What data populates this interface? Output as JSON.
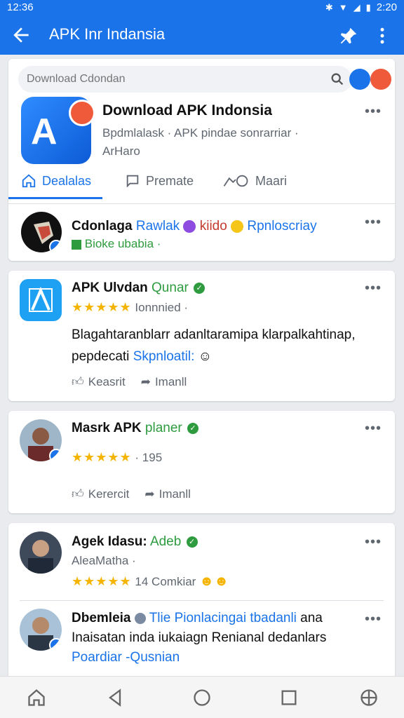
{
  "status_bar": {
    "time": "12:36",
    "clock_right": "2:20"
  },
  "app_bar": {
    "title": "APK Inr Indansia"
  },
  "header": {
    "search_placeholder": "Download Cdondan",
    "app_name": "Download APK Indonsia",
    "app_sub": "Bpdmlalask · APK pindae sonrarriar ·",
    "app_sub2": "ArHaro",
    "logo_text": "A",
    "tabs": [
      {
        "label": "Dealalas",
        "icon": "home-outline-icon",
        "active": true
      },
      {
        "label": "Premate",
        "icon": "chat-icon",
        "active": false
      },
      {
        "label": "Maari",
        "icon": "share-icon",
        "active": false
      }
    ]
  },
  "posts": [
    {
      "name": "Cdonlaga",
      "tags": [
        "Rawlak",
        "kiido",
        "Rpnloscriay"
      ],
      "meta": "Bioke ubabia ·"
    },
    {
      "name": "APK Ulvdan",
      "name_tag": "Qunar",
      "stars": "★★★★★",
      "meta": "Ionnnied ·",
      "text": "Blagahtaranblarr adanltaramipa klarpalkahtinap,",
      "text2_plain": "pepdecati",
      "text2_link": "Skpnloatil:",
      "actions": [
        "Keasrit",
        "Imanll"
      ]
    },
    {
      "name": "Masrk APK",
      "name_tag": "planer",
      "stars": "★★★★★",
      "meta": "· 195",
      "actions": [
        "Kerercit",
        "Imanll"
      ]
    },
    {
      "name": "Agek Idasu:",
      "name_tag": "Adeb",
      "meta": "AleaMatha ·",
      "stars": "★★★★★",
      "rating_text": "14 Comkiar"
    },
    {
      "name": "Dbemleia",
      "comment_link": "Tlie Pionlacingai tbadanli",
      "comment_tail": "ana",
      "comment_line2": "Inaisatan inda iukaiagn Renianal dedanlars",
      "comment_line3": "Poardiar -Qusnian"
    }
  ],
  "colors": {
    "brand_blue": "#1a73e8",
    "green": "#2e9b3f",
    "star": "#f4b400"
  }
}
